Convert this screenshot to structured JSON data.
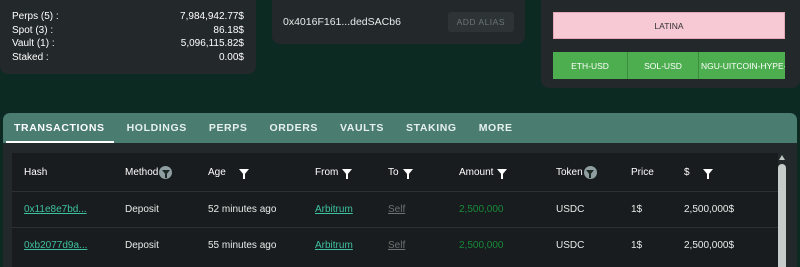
{
  "balances": [
    {
      "label": "Perps (5) :",
      "value": "7,984,942.77$"
    },
    {
      "label": "Spot (3) :",
      "value": "86.18$"
    },
    {
      "label": "Vault (1) :",
      "value": "5,096,115.82$"
    },
    {
      "label": "Staked :",
      "value": "0.00$"
    }
  ],
  "address": {
    "text": "0x4016F161...dedSACb6",
    "add_alias_label": "ADD ALIAS"
  },
  "tags": {
    "highlight": "LATINA",
    "pairs": [
      "ETH-USD",
      "SOL-USD",
      "NGU-UITCOIN-HYPE-US"
    ]
  },
  "tabs": [
    "TRANSACTIONS",
    "HOLDINGS",
    "PERPS",
    "ORDERS",
    "VAULTS",
    "STAKING",
    "MORE"
  ],
  "table": {
    "headers": [
      "Hash",
      "Method",
      "Age",
      "From",
      "To",
      "Amount",
      "Token",
      "Price",
      "$"
    ],
    "rows": [
      [
        "0x11e8e7bd...",
        "Deposit",
        "52 minutes ago",
        "Arbitrum",
        "Self",
        "2,500,000",
        "USDC",
        "1$",
        "2,500,000$"
      ],
      [
        "0xb2077d9a...",
        "Deposit",
        "55 minutes ago",
        "Arbitrum",
        "Self",
        "2,500,000",
        "USDC",
        "1$",
        "2,500,000$"
      ]
    ]
  },
  "colors": {
    "accent": "#4a7c70",
    "link": "#3ec1a2",
    "amount": "#178a3a",
    "latina_bg": "#f7c9d4",
    "pair_bg": "#4cae4f"
  }
}
